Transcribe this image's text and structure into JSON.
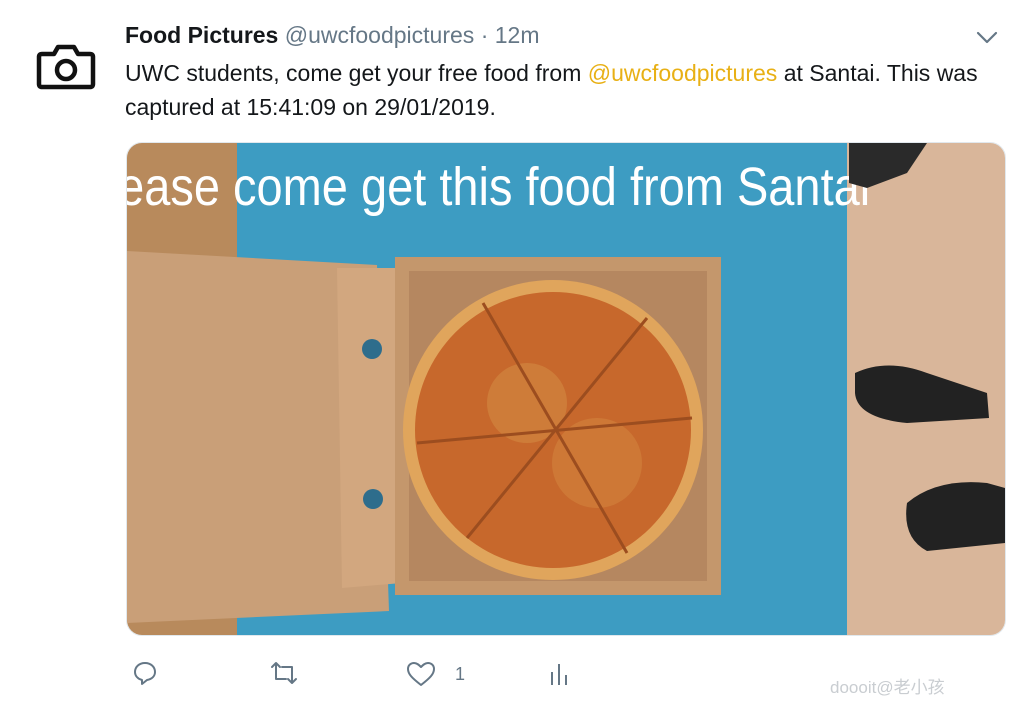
{
  "tweet": {
    "display_name": "Food Pictures",
    "handle": "@uwcfoodpictures",
    "separator": "·",
    "time": "12m",
    "text_before": "UWC students, come get your free food from ",
    "mention": "@uwcfoodpictures",
    "text_after": " at Santai. This was captured at 15:41:09 on 29/01/2019."
  },
  "media": {
    "sign_text": "Please come get this food from Santai"
  },
  "actions": {
    "like_count": "1"
  },
  "watermark": "doooit@老小孩",
  "icons": [
    "camera-icon",
    "chevron-down-icon",
    "reply-icon",
    "retweet-icon",
    "like-icon",
    "analytics-icon"
  ],
  "colors": {
    "mention": "#e8b015",
    "muted": "#657786",
    "sign_bg": "#3d9cc2"
  }
}
